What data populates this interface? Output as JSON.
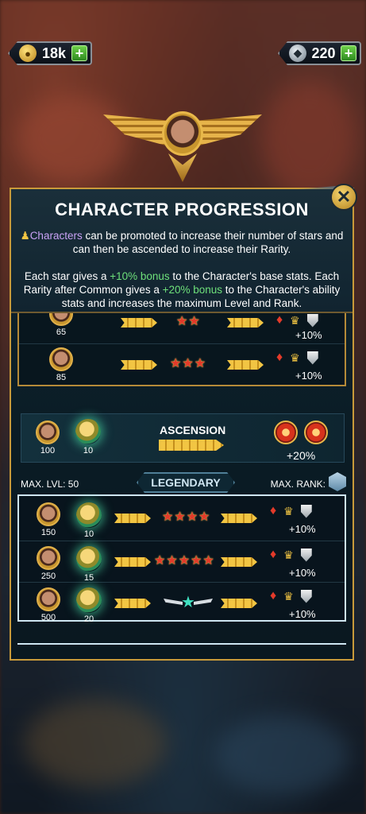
{
  "currency": {
    "gold": "18k",
    "gold_icon": "gold-coin-icon",
    "gems": "220",
    "gems_icon": "crystal-icon",
    "plus": "+"
  },
  "panel": {
    "title": "CHARACTER PROGRESSION",
    "line1_a": "Characters",
    "line1_b": " can be promoted to increase their number of stars and can then be ascended to increase their Rarity.",
    "line2_a": "Each star gives a ",
    "line2_b": "+10% bonus",
    "line2_c": " to the Character's base stats. Each Rarity after Common gives a ",
    "line2_d": "+20% bonus",
    "line2_e": " to the Character's ability stats and increases the maximum Level and Rank.",
    "close": "✕"
  },
  "upper_rows": [
    {
      "level": "65",
      "stars": 2,
      "bonus": "+10%"
    },
    {
      "level": "85",
      "stars": 3,
      "bonus": "+10%"
    }
  ],
  "ascension": {
    "label": "ASCENSION",
    "level": "100",
    "medals": "10",
    "bonus": "+20%"
  },
  "legendary": {
    "max_lvl": "MAX. LVL: 50",
    "max_rank": "MAX. RANK:",
    "tag": "LEGENDARY",
    "rows": [
      {
        "level": "150",
        "medals": "10",
        "stars": 4,
        "bonus": "+10%"
      },
      {
        "level": "250",
        "medals": "15",
        "stars": 5,
        "bonus": "+10%"
      },
      {
        "level": "500",
        "medals": "20",
        "stars": "winged",
        "bonus": "+10%"
      }
    ]
  },
  "colors": {
    "gold_border": "#c99a3a",
    "green_bonus": "#6ee07a",
    "purple": "#c9a2f6"
  }
}
